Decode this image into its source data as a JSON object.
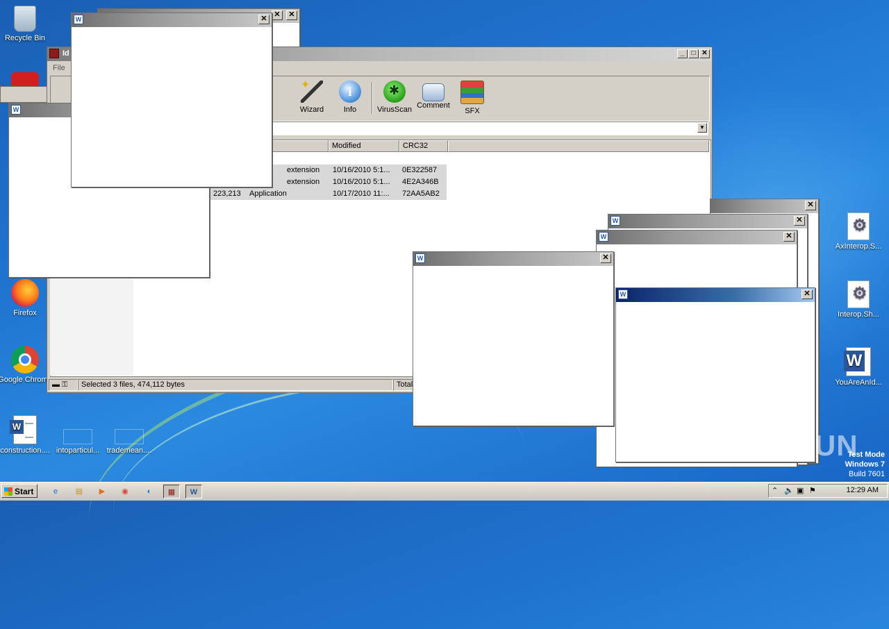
{
  "desktop": {
    "icons": [
      {
        "label": "Recycle Bin",
        "icon": "recycle-bin-icon"
      },
      {
        "label": "Firefox",
        "icon": "firefox-icon"
      },
      {
        "label": "Google Chrome",
        "icon": "chrome-icon"
      },
      {
        "label": "construction....",
        "icon": "word-document-icon"
      },
      {
        "label": "intoparticul...",
        "icon": "blank-file-icon"
      },
      {
        "label": "trademean....",
        "icon": "blank-file-icon"
      },
      {
        "label": "AxInterop.S...",
        "icon": "config-file-icon"
      },
      {
        "label": "Interop.Sh...",
        "icon": "config-file-icon"
      },
      {
        "label": "YouAreAnId...",
        "icon": "word-document-icon"
      }
    ]
  },
  "winrar": {
    "title": "Id",
    "menu_file": "File",
    "tools": [
      {
        "label": "Wizard",
        "icon": "wizard-wand-icon"
      },
      {
        "label": "Info",
        "icon": "info-icon"
      },
      {
        "label": "VirusScan",
        "icon": "virusscan-bug-icon"
      },
      {
        "label": "Comment",
        "icon": "comment-icon"
      },
      {
        "label": "SFX",
        "icon": "sfx-archive-icon"
      }
    ],
    "columns": {
      "modified": "Modified",
      "crc": "CRC32"
    },
    "rows": [
      {
        "size": "",
        "type": "extension",
        "modified": "10/16/2010 5:1...",
        "crc": "0E322587"
      },
      {
        "size": "",
        "type": "extension",
        "modified": "10/16/2010 5:1...",
        "crc": "4E2A346B"
      },
      {
        "size": "223,213",
        "type": "Application",
        "modified": "10/17/2010 11:...",
        "crc": "72AA5AB2"
      }
    ],
    "status_selected": "Selected 3 files, 474,112 bytes",
    "status_total": "Total"
  },
  "taskbar": {
    "start": "Start",
    "time": "12:29 AM"
  },
  "watermark": "ANY RUN",
  "testmode": {
    "line1": "Test Mode",
    "line2": "Windows 7",
    "line3": "Build 7601"
  },
  "popup_close": "✕"
}
